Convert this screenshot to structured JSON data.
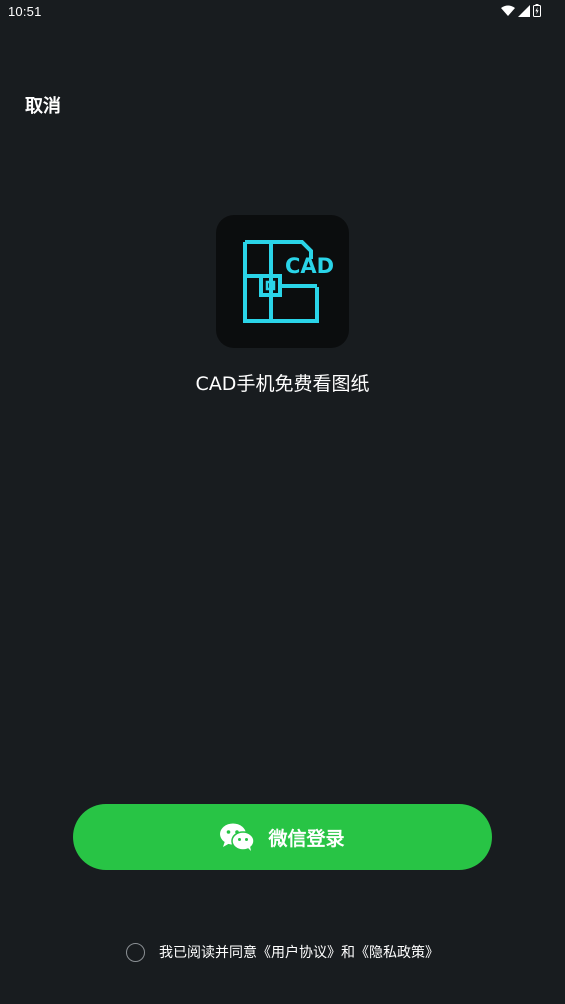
{
  "status_bar": {
    "time": "10:51",
    "icons": [
      "wifi-icon",
      "signal-icon",
      "battery-icon"
    ]
  },
  "header": {
    "cancel_label": "取消"
  },
  "app": {
    "logo_text": "CAD",
    "name": "CAD手机免费看图纸"
  },
  "login": {
    "wechat_button_label": "微信登录",
    "icon": "wechat-icon"
  },
  "agreement": {
    "checked": false,
    "prefix": "我已阅读并同意",
    "user_agreement": "《用户协议》",
    "conjunction": "和",
    "privacy_policy": "《隐私政策》"
  },
  "colors": {
    "background": "#181c1f",
    "accent_green": "#28c445",
    "logo_cyan": "#2ad4e8",
    "logo_bg": "#0b0d0e"
  }
}
